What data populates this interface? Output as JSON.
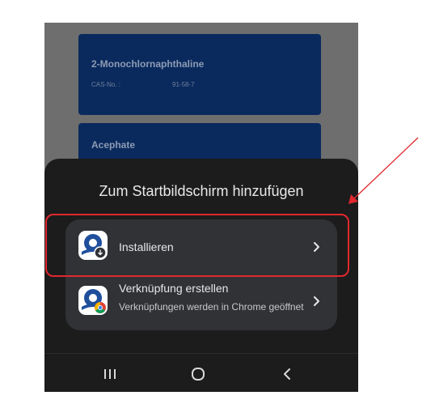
{
  "background_cards": [
    {
      "name": "2-Monochlornaphthaline",
      "cas_label": "CAS-No. :",
      "cas_number": "91-58-7"
    },
    {
      "name": "Acephate"
    }
  ],
  "sheet": {
    "title": "Zum Startbildschirm hinzufügen",
    "options": [
      {
        "label": "Installieren",
        "badge_icon": "download-icon"
      },
      {
        "label": "Verknüpfung erstellen",
        "sublabel": "Verknüpfungen werden in Chrome geöffnet",
        "badge_icon": "chrome-icon"
      }
    ]
  },
  "navbar": {
    "buttons": [
      "recents-icon",
      "home-icon",
      "back-icon"
    ]
  },
  "colors": {
    "sheet_bg": "#1c1c1c",
    "option_group_bg": "#303236",
    "card_bg": "#0a2a5e",
    "annotation": "#e0282e"
  }
}
